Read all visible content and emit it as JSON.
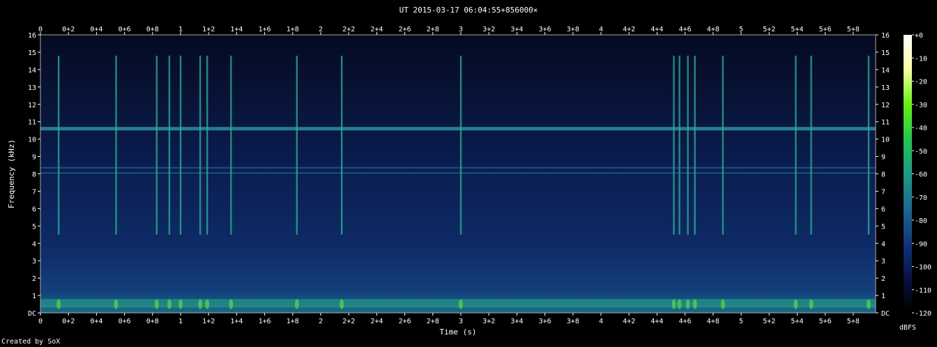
{
  "title": "UT 2015-03-17 06:04:55+856000×",
  "credit": "Created by SoX",
  "chart_data": {
    "type": "heatmap",
    "title": "UT 2015-03-17 06:04:55+856000×",
    "xlabel": "Time (s)",
    "ylabel": "Frequency (kHz)",
    "colorbar_label": "dBFS",
    "xlim": [
      0,
      5.96
    ],
    "ylim": [
      0,
      16
    ],
    "xticks": [
      "0",
      "0+2",
      "0+4",
      "0+6",
      "0+8",
      "1",
      "1+2",
      "1+4",
      "1+6",
      "1+8",
      "2",
      "2+2",
      "2+4",
      "2+6",
      "2+8",
      "3",
      "3+2",
      "3+4",
      "3+6",
      "3+8",
      "4",
      "4+2",
      "4+4",
      "4+6",
      "4+8",
      "5",
      "5+2",
      "5+4",
      "5+6",
      "5+8"
    ],
    "xtick_values": [
      0,
      0.2,
      0.4,
      0.6,
      0.8,
      1,
      1.2,
      1.4,
      1.6,
      1.8,
      2,
      2.2,
      2.4,
      2.6,
      2.8,
      3,
      3.2,
      3.4,
      3.6,
      3.8,
      4,
      4.2,
      4.4,
      4.6,
      4.8,
      5,
      5.2,
      5.4,
      5.6,
      5.8
    ],
    "yticks": [
      "DC",
      "1",
      "2",
      "3",
      "4",
      "5",
      "6",
      "7",
      "8",
      "9",
      "10",
      "11",
      "12",
      "13",
      "14",
      "15",
      "16"
    ],
    "colorbar_ticks": [
      "+0",
      "-10",
      "-20",
      "-30",
      "-40",
      "-50",
      "-60",
      "-70",
      "-80",
      "-90",
      "-100",
      "-110",
      "-120"
    ],
    "colorbar_range": [
      -120,
      0
    ],
    "colors": [
      "#000000",
      "#0a1040",
      "#10357a",
      "#1d6a8f",
      "#1f9a86",
      "#22c455",
      "#66ee11",
      "#ffffaa",
      "#ffffff"
    ],
    "features": {
      "horizontal_lines_khz": [
        10.6,
        8.35,
        8.05
      ],
      "vertical_clicks_s": [
        0.13,
        0.54,
        0.83,
        0.92,
        1.0,
        1.14,
        1.19,
        1.36,
        1.83,
        2.15,
        3.0,
        4.52,
        4.56,
        4.62,
        4.67,
        4.87,
        5.39,
        5.5,
        5.91
      ]
    }
  }
}
